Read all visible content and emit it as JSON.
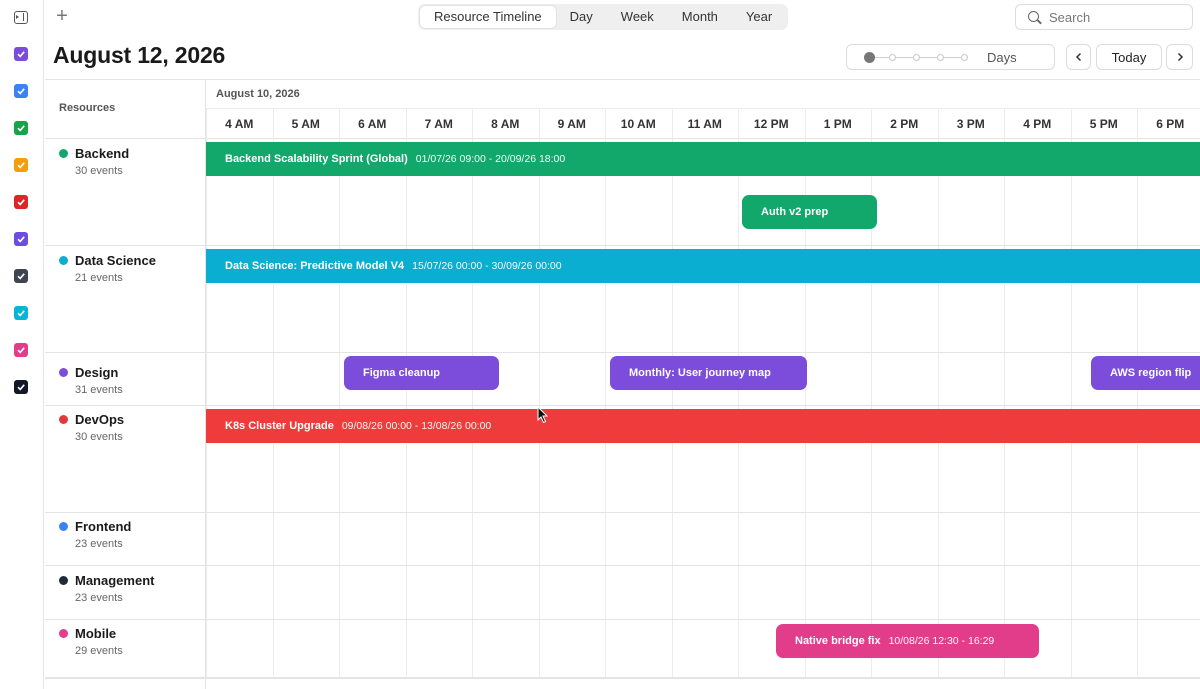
{
  "toolbar": {
    "add_label": "+",
    "tabs": [
      "Resource Timeline",
      "Day",
      "Week",
      "Month",
      "Year"
    ],
    "active_tab": "Resource Timeline",
    "search_placeholder": "Search"
  },
  "header": {
    "title": "August 12, 2026",
    "zoom_label": "Days",
    "zoom_level": 0,
    "today_label": "Today"
  },
  "calendars": [
    {
      "color": "#7c4ddb",
      "checked": true
    },
    {
      "color": "#3b82f6",
      "checked": true
    },
    {
      "color": "#16a34a",
      "checked": true
    },
    {
      "color": "#f59e0b",
      "checked": true
    },
    {
      "color": "#dc2626",
      "checked": true
    },
    {
      "color": "#6d4ce0",
      "checked": true
    },
    {
      "color": "#3f4451",
      "checked": true
    },
    {
      "color": "#06b6d4",
      "checked": true
    },
    {
      "color": "#e23d8a",
      "checked": true
    },
    {
      "color": "#111827",
      "checked": true
    }
  ],
  "timeline": {
    "resources_header": "Resources",
    "date_label": "August 10, 2026",
    "hours": [
      "4 AM",
      "5 AM",
      "6 AM",
      "7 AM",
      "8 AM",
      "9 AM",
      "10 AM",
      "11 AM",
      "12 PM",
      "1 PM",
      "2 PM",
      "3 PM",
      "4 PM",
      "5 PM",
      "6 PM"
    ]
  },
  "resources": [
    {
      "name": "Backend",
      "count": "30 events",
      "color": "#12a86b"
    },
    {
      "name": "Data Science",
      "count": "21 events",
      "color": "#0aaed0"
    },
    {
      "name": "Design",
      "count": "31 events",
      "color": "#7c4ddb"
    },
    {
      "name": "DevOps",
      "count": "30 events",
      "color": "#e23a3a"
    },
    {
      "name": "Frontend",
      "count": "23 events",
      "color": "#3b82f6"
    },
    {
      "name": "Management",
      "count": "23 events",
      "color": "#1f2937"
    },
    {
      "name": "Mobile",
      "count": "29 events",
      "color": "#e23d8a"
    }
  ],
  "events": [
    {
      "title": "Backend Scalability Sprint (Global)",
      "range": "01/07/26 09:00 - 20/09/26 18:00",
      "color": "#12a86b"
    },
    {
      "title": "Auth v2 prep",
      "range": "",
      "color": "#12a86b"
    },
    {
      "title": "Data Science: Predictive Model V4",
      "range": "15/07/26 00:00 - 30/09/26 00:00",
      "color": "#0aaed0"
    },
    {
      "title": "Figma cleanup",
      "range": "",
      "color": "#7c4ddb"
    },
    {
      "title": "Monthly: User journey map",
      "range": "",
      "color": "#7c4ddb"
    },
    {
      "title": "AWS region flip",
      "range": "",
      "color": "#7c4ddb"
    },
    {
      "title": "K8s Cluster Upgrade",
      "range": "09/08/26 00:00 - 13/08/26 00:00",
      "color": "#ef3b3b"
    },
    {
      "title": "Native bridge fix",
      "range": "10/08/26 12:30 - 16:29",
      "color": "#e23d8a"
    }
  ]
}
